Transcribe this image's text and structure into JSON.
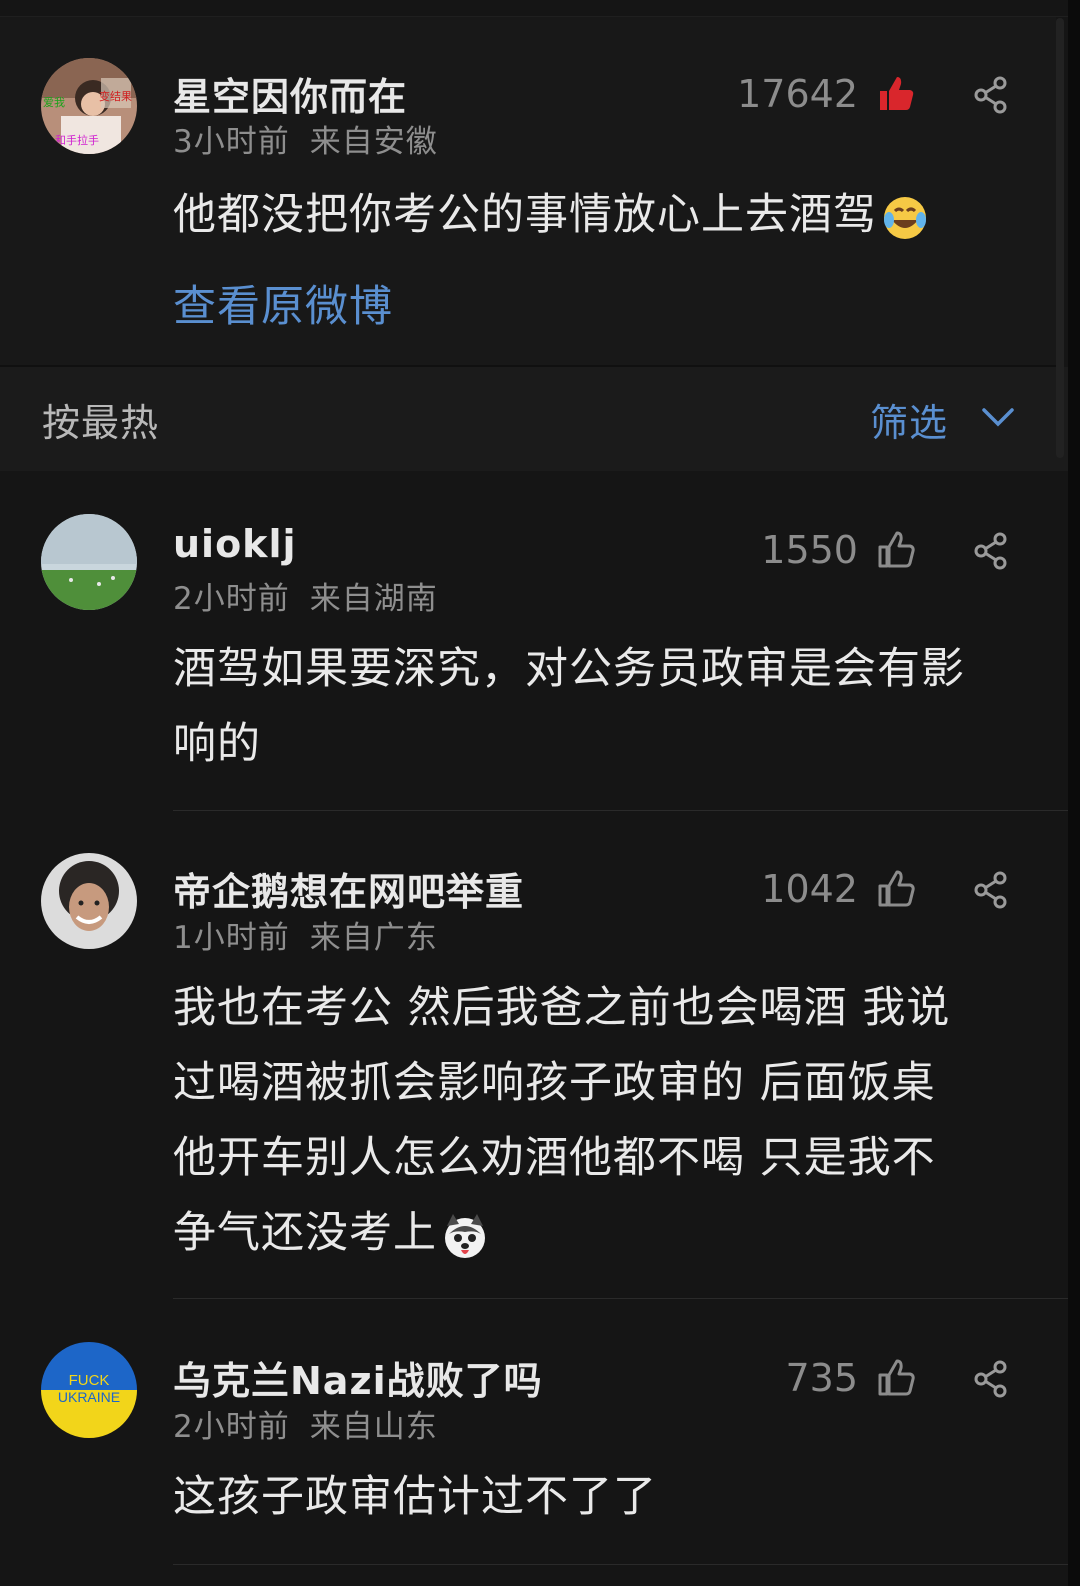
{
  "top_comment": {
    "username": "星空因你而在",
    "time": "3小时前",
    "location": "来自安徽",
    "likes": "17642",
    "liked": true,
    "text": "他都没把你考公的事情放心上去酒驾",
    "emoji": "laughing-crying-emoji",
    "link": "查看原微博",
    "avatar_text": [
      "爱我",
      "变结果",
      "和手拉手"
    ]
  },
  "sort_bar": {
    "sort_label": "按最热",
    "filter_label": "筛选"
  },
  "comments": [
    {
      "username": "uioklj",
      "time": "2小时前",
      "location": "来自湖南",
      "likes": "1550",
      "lines": [
        "酒驾如果要深究，对公务员政审是会有影",
        "响的"
      ]
    },
    {
      "username": "帝企鹅想在网吧举重",
      "time": "1小时前",
      "location": "来自广东",
      "likes": "1042",
      "lines": [
        "我也在考公 然后我爸之前也会喝酒 我说",
        "过喝酒被抓会影响孩子政审的 后面饭桌",
        "他开车别人怎么劝酒他都不喝 只是我不",
        "争气还没考上"
      ],
      "emoji": "husky-dog-emoji"
    },
    {
      "username": "乌克兰Nazi战败了吗",
      "time": "2小时前",
      "location": "来自山东",
      "likes": "735",
      "lines": [
        "这孩子政审估计过不了了"
      ],
      "avatar_text": [
        "FUCK",
        "UKRAINE"
      ]
    }
  ],
  "colors": {
    "background": "#151515",
    "link": "#5a8fd0",
    "liked_red": "#d9262c",
    "muted": "#8e8e8e"
  },
  "icons": {
    "like": "thumb-up-icon",
    "share": "share-icon",
    "chevron": "chevron-down-icon"
  }
}
